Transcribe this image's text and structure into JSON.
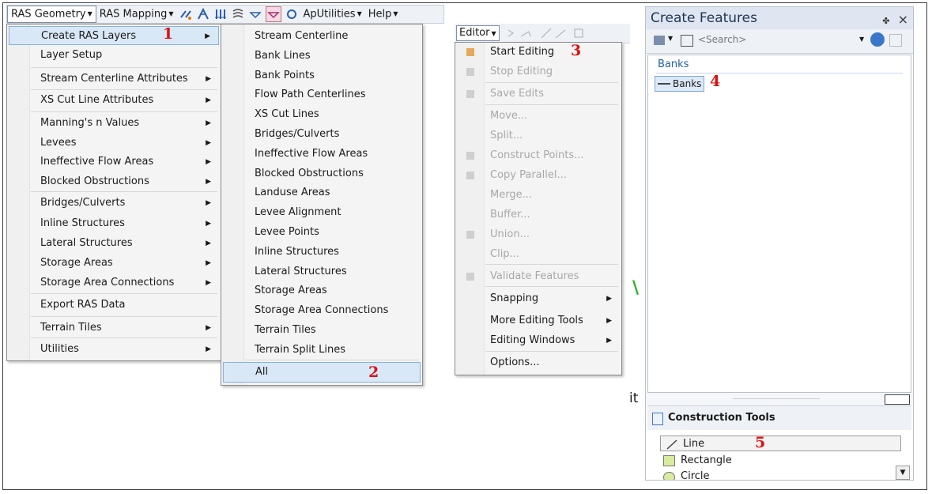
{
  "toolbar": {
    "menus": [
      "RAS Geometry",
      "RAS Mapping",
      "ApUtilities",
      "Help"
    ],
    "icons": [
      "bank-lines-icon",
      "flow-paths-icon",
      "cross-sections-icon",
      "storage-icon",
      "levee-down-icon",
      "levee-selected-icon",
      "refresh-icon"
    ]
  },
  "ras_geometry_menu": {
    "items": [
      {
        "label": "Create RAS Layers",
        "submenu": true,
        "highlight": true
      },
      {
        "label": "Layer Setup",
        "submenu": false
      },
      {
        "label": "Stream Centerline Attributes",
        "submenu": true
      },
      {
        "label": "XS Cut Line Attributes",
        "submenu": true
      },
      {
        "label": "Manning's n Values",
        "submenu": true
      },
      {
        "label": "Levees",
        "submenu": true
      },
      {
        "label": "Ineffective Flow Areas",
        "submenu": true
      },
      {
        "label": "Blocked Obstructions",
        "submenu": true
      },
      {
        "label": "Bridges/Culverts",
        "submenu": true
      },
      {
        "label": "Inline Structures",
        "submenu": true
      },
      {
        "label": "Lateral Structures",
        "submenu": true
      },
      {
        "label": "Storage Areas",
        "submenu": true
      },
      {
        "label": "Storage Area Connections",
        "submenu": true
      },
      {
        "label": "Export RAS Data",
        "submenu": false
      },
      {
        "label": "Terrain Tiles",
        "submenu": true
      },
      {
        "label": "Utilities",
        "submenu": true
      }
    ]
  },
  "create_layers_submenu": {
    "items": [
      "Stream Centerline",
      "Bank Lines",
      "Bank Points",
      "Flow Path Centerlines",
      "XS Cut Lines",
      "Bridges/Culverts",
      "Ineffective Flow Areas",
      "Blocked Obstructions",
      "Landuse Areas",
      "Levee Alignment",
      "Levee Points",
      "Inline Structures",
      "Lateral Structures",
      "Storage Areas",
      "Storage Area Connections",
      "Terrain Tiles",
      "Terrain Split Lines"
    ],
    "all_label": "All"
  },
  "editor": {
    "button_label": "Editor",
    "items": [
      {
        "label": "Start Editing",
        "enabled": true
      },
      {
        "label": "Stop Editing",
        "enabled": false
      },
      {
        "label": "Save Edits",
        "enabled": false
      },
      {
        "label": "Move...",
        "enabled": false
      },
      {
        "label": "Split...",
        "enabled": false
      },
      {
        "label": "Construct Points...",
        "enabled": false
      },
      {
        "label": "Copy Parallel...",
        "enabled": false
      },
      {
        "label": "Merge...",
        "enabled": false
      },
      {
        "label": "Buffer...",
        "enabled": false
      },
      {
        "label": "Union...",
        "enabled": false
      },
      {
        "label": "Clip...",
        "enabled": false
      },
      {
        "label": "Validate Features",
        "enabled": false
      },
      {
        "label": "Snapping",
        "enabled": true,
        "submenu": true
      },
      {
        "label": "More Editing Tools",
        "enabled": true,
        "submenu": true
      },
      {
        "label": "Editing Windows",
        "enabled": true,
        "submenu": true
      },
      {
        "label": "Options...",
        "enabled": true
      }
    ]
  },
  "create_features": {
    "title": "Create Features",
    "pin": "✤",
    "close": "×",
    "search_placeholder": "<Search>",
    "group_header": "Banks",
    "template_label": "Banks",
    "construction_tools_title": "Construction Tools",
    "tools": [
      "Line",
      "Rectangle",
      "Circle"
    ]
  },
  "step_numbers": [
    "1",
    "2",
    "3",
    "4",
    "5"
  ],
  "stray_text": {
    "letter_v": "\\",
    "letter_it": "it"
  },
  "colors": {
    "highlight": "#d9e8f7",
    "annotation": "#dd1111",
    "disabled": "#a8a8a8"
  }
}
